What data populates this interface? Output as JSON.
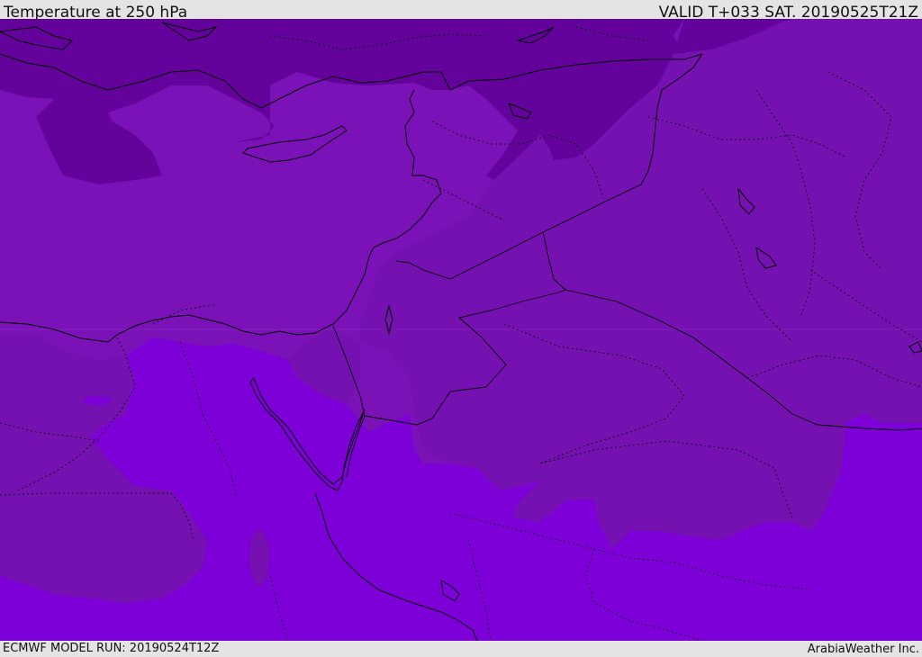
{
  "header": {
    "title": "Temperature at 250 hPa",
    "valid": "VALID T+033 SAT. 20190525T21Z"
  },
  "footer": {
    "model_run": "ECMWF MODEL RUN: 20190524T12Z",
    "credit": "ArabiaWeather Inc."
  },
  "colors": {
    "coldest_band": "#64039b",
    "cold_band": "#7a12b8",
    "mid_band": "#7411b0",
    "warm_band": "#7d00d8",
    "coastline": "#000000",
    "borders": "#000000",
    "chrome_background": "#e4e4e4"
  }
}
